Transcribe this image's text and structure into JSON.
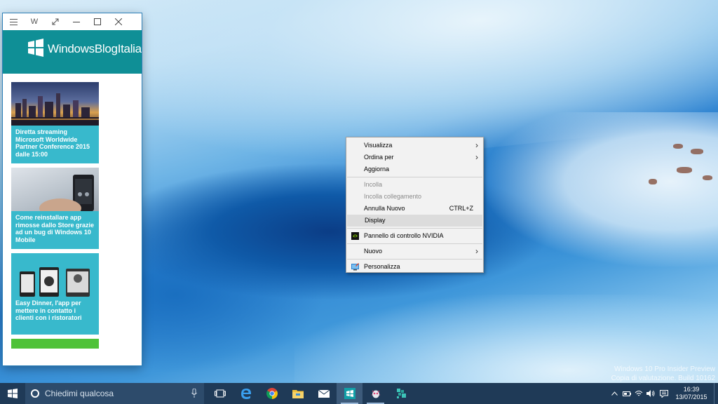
{
  "app_window": {
    "title_letter": "W",
    "brand": "WindowsBlogItalia",
    "cards": [
      {
        "caption": "Diretta streaming Microsoft Worldwide Partner Conference 2015 dalle 15:00",
        "image": "city-skyline"
      },
      {
        "caption": "Come reinstallare app rimosse dallo Store grazie ad un bug di Windows 10 Mobile",
        "image": "phone-in-hand"
      },
      {
        "caption": "Easy Dinner, l'app per mettere in contatto i clienti con i ristoratori",
        "image": "app-screenshots"
      }
    ]
  },
  "context_menu": {
    "items": [
      {
        "label": "Visualizza",
        "submenu": true
      },
      {
        "label": "Ordina per",
        "submenu": true
      },
      {
        "label": "Aggiorna"
      },
      {
        "label": "Incolla",
        "disabled": true
      },
      {
        "label": "Incolla collegamento",
        "disabled": true
      },
      {
        "label": "Annulla Nuovo",
        "shortcut": "CTRL+Z"
      },
      {
        "label": "Display",
        "highlighted": true
      },
      {
        "label": "Pannello di controllo NVIDIA",
        "icon": "nvidia-icon"
      },
      {
        "label": "Nuovo",
        "submenu": true
      },
      {
        "label": "Personalizza",
        "icon": "personalize-icon"
      }
    ]
  },
  "watermark": {
    "line1": "Windows 10 Pro Insider Preview",
    "line2": "Copia di valutazione. Build 10162"
  },
  "taskbar": {
    "search_placeholder": "Chiedimi qualcosa",
    "apps": [
      "task-view-icon",
      "edge-icon",
      "chrome-icon",
      "file-explorer-icon",
      "mail-icon",
      "windowsblogitalia-app-icon",
      "bug-app-icon",
      "sway-icon"
    ],
    "time": "16:39",
    "date": "13/07/2015"
  },
  "colors": {
    "app_header": "#0f8f96",
    "card_caption": "#38b9cc",
    "taskbar": "#1f3a57"
  }
}
